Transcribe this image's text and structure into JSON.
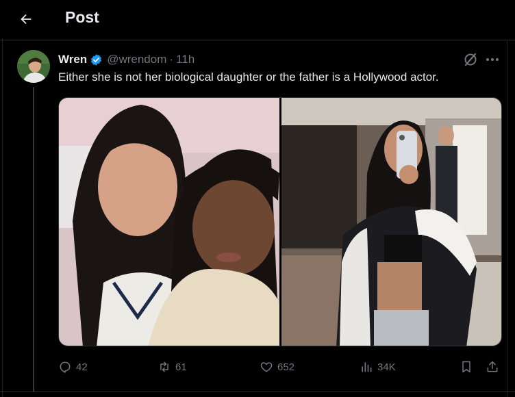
{
  "header": {
    "title": "Post"
  },
  "tweet": {
    "author_name": "Wren",
    "handle": "@wrendom",
    "separator": "·",
    "time": "11h",
    "text": "Either she is not her biological daughter or the father is a Hollywood actor.",
    "verified": true
  },
  "actions": {
    "replies": "42",
    "reposts": "61",
    "likes": "652",
    "views": "34K"
  },
  "colors": {
    "background": "#000000",
    "text": "#e7e9ea",
    "muted": "#71767b",
    "verified": "#1d9bf0",
    "border": "#2f3336"
  },
  "icons": [
    "back-arrow-icon",
    "verified-badge-icon",
    "grok-icon",
    "more-icon",
    "reply-icon",
    "repost-icon",
    "like-icon",
    "views-icon",
    "bookmark-icon",
    "share-icon"
  ]
}
